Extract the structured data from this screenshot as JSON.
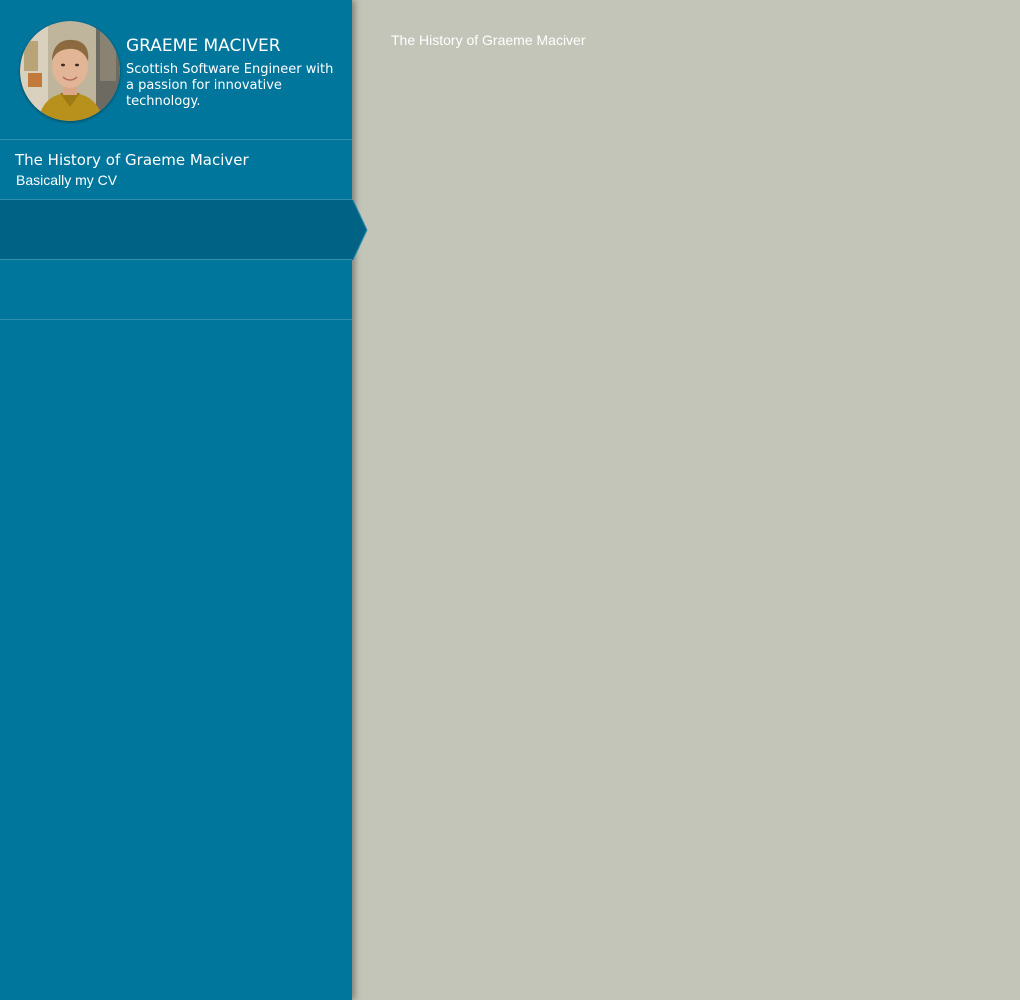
{
  "colors": {
    "sidebar": "#00769c",
    "sidebar_active": "#006285",
    "divider": "#2f90b0",
    "content_bg": "#c3c5b8",
    "text": "#ffffff"
  },
  "profile": {
    "name": "GRAEME MACIVER",
    "tagline": "Scottish Software Engineer with a passion for innovative technology.",
    "avatar_icon": "profile-photo"
  },
  "sidebar": {
    "items": [
      {
        "title": "The History of Graeme Maciver",
        "subtitle": "Basically my CV",
        "active": false
      },
      {
        "title": "",
        "subtitle": "",
        "active": true
      },
      {
        "title": "",
        "subtitle": "",
        "active": false
      }
    ]
  },
  "main": {
    "title": "The History of Graeme Maciver"
  }
}
